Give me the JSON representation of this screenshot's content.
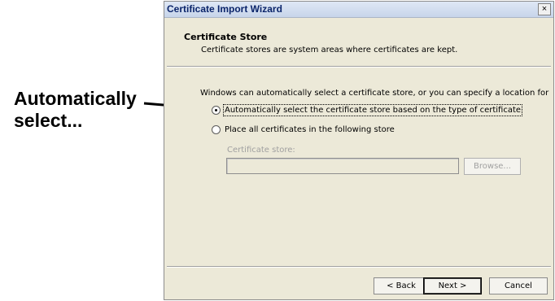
{
  "callout": {
    "line1": "Automatically",
    "line2": "select..."
  },
  "dialog": {
    "title": "Certificate Import Wizard",
    "close_glyph": "×",
    "header_title": "Certificate Store",
    "header_desc": "Certificate stores are system areas where certificates are kept.",
    "intro": "Windows can automatically select a certificate store, or you can specify a location for",
    "option_auto": "Automatically select the certificate store based on the type of certificate",
    "option_auto_selected": true,
    "option_place": "Place all certificates in the following store",
    "store_label": "Certificate store:",
    "store_value": "",
    "browse_label": "Browse...",
    "back_label": "< Back",
    "next_label": "Next >",
    "cancel_label": "Cancel"
  },
  "colors": {
    "dialog_bg": "#ece9d8",
    "title_text": "#0a246a",
    "disabled_text": "#a0a0a0"
  }
}
